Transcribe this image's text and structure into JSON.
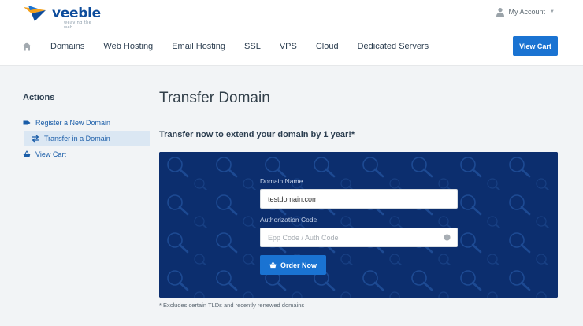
{
  "brand": {
    "name": "veeble",
    "tagline": "weaving the web",
    "colors": {
      "primary": "#1a73d2",
      "panel": "#0c2e6e",
      "logo": "#0d4c9c"
    }
  },
  "header": {
    "account_label": "My Account",
    "account_icon": "user-icon",
    "nav": {
      "home_icon": "home-icon",
      "items": [
        "Domains",
        "Web Hosting",
        "Email Hosting",
        "SSL",
        "VPS",
        "Cloud",
        "Dedicated Servers"
      ]
    },
    "cart_button": "View Cart"
  },
  "sidebar": {
    "title": "Actions",
    "items": [
      {
        "label": "Register a New Domain",
        "icon": "tag-icon",
        "active": false
      },
      {
        "label": "Transfer in a Domain",
        "icon": "exchange-icon",
        "active": true
      },
      {
        "label": "View Cart",
        "icon": "basket-icon",
        "active": false
      }
    ]
  },
  "main": {
    "title": "Transfer Domain",
    "subtitle": "Transfer now to extend your domain by 1 year!*",
    "form": {
      "domain_label": "Domain Name",
      "domain_value": "testdomain.com",
      "auth_label": "Authorization Code",
      "auth_placeholder": "Epp Code / Auth Code",
      "auth_icon": "info-icon",
      "submit_label": "Order Now",
      "submit_icon": "basket-icon"
    },
    "footnote": "* Excludes certain TLDs and recently renewed domains"
  }
}
